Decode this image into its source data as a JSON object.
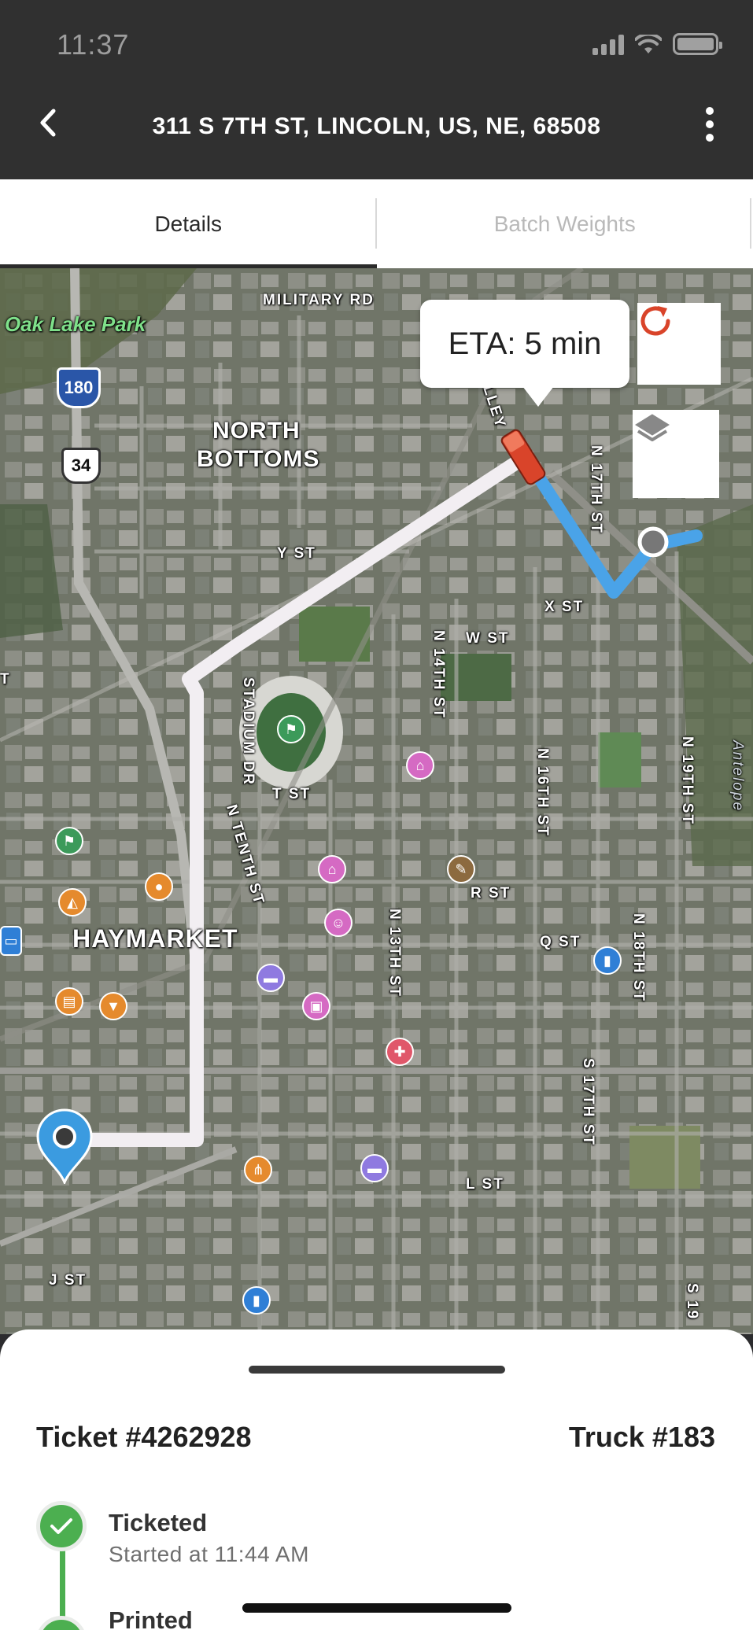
{
  "status_bar": {
    "time": "11:37"
  },
  "header": {
    "title": "311 S 7TH ST, LINCOLN, US, NE, 68508"
  },
  "tabs": [
    {
      "label": "Details",
      "active": true
    },
    {
      "label": "Batch Weights",
      "active": false
    }
  ],
  "map": {
    "eta": "ETA: 5 min",
    "labels": {
      "military_rd": "MILITARY RD",
      "oak_lake_park": "Oak Lake Park",
      "i180": "180",
      "us34": "34",
      "north": "NORTH",
      "bottoms": "BOTTOMS",
      "y_st": "Y ST",
      "x_st": "X ST",
      "w_st": "W ST",
      "n17th": "N 17TH ST",
      "n14th": "N 14TH ST",
      "n16th": "N 16TH ST",
      "n19th": "N 19TH ST",
      "stadium_dr": "STADIUM DR",
      "t_st": "T ST",
      "n_tenth": "N TENTH ST",
      "r_st": "R ST",
      "q_st": "Q ST",
      "haymarket": "HAYMARKET",
      "n13th": "N 13TH ST",
      "n18th": "N 18TH ST",
      "s17th": "S 17TH ST",
      "l_st": "L ST",
      "j_st": "J ST",
      "antelope": "Antelope",
      "s19": "S 19",
      "valley": "VALLEY",
      "t_left": "T"
    }
  },
  "sheet": {
    "ticket": "Ticket #4262928",
    "truck": "Truck #183",
    "steps": [
      {
        "title": "Ticketed",
        "subtitle": "Started at 11:44 AM"
      },
      {
        "title": "Printed"
      }
    ]
  },
  "colors": {
    "header_bg": "#303030",
    "route_done": "#f2eef2",
    "route_remaining": "#4aa3e8",
    "accent_refresh": "#d9442a",
    "step_green": "#4caf50",
    "pin_blue": "#3b9be0",
    "truck_red": "#d9442a"
  }
}
